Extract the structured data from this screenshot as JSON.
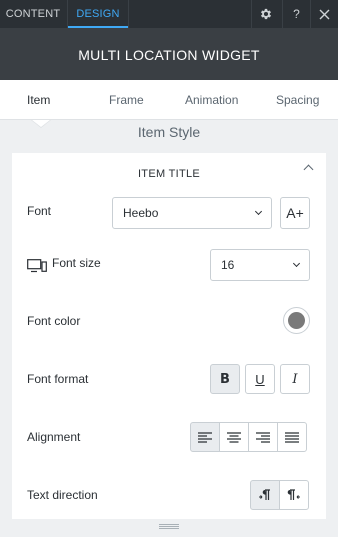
{
  "topbar": {
    "tabs": [
      {
        "label": "CONTENT",
        "active": false
      },
      {
        "label": "DESIGN",
        "active": true
      }
    ],
    "icons": {
      "settings": "gear-icon",
      "help": "?",
      "close": "close-icon"
    }
  },
  "title": "MULTI LOCATION WIDGET",
  "nav": [
    {
      "label": "Item",
      "active": true
    },
    {
      "label": "Frame",
      "active": false
    },
    {
      "label": "Animation",
      "active": false
    },
    {
      "label": "Spacing",
      "active": false
    }
  ],
  "section_caption": "Item Style",
  "panel": {
    "header": "ITEM TITLE",
    "font": {
      "label": "Font",
      "value": "Heebo",
      "add_label": "A+"
    },
    "font_size": {
      "label": "Font size",
      "value": "16"
    },
    "font_color": {
      "label": "Font color",
      "color": "#7a7a7a"
    },
    "font_format": {
      "label": "Font format",
      "bold": "B",
      "underline": "U",
      "italic": "I",
      "bold_active": true
    },
    "alignment": {
      "label": "Alignment",
      "options": [
        "left",
        "center",
        "right",
        "justify"
      ],
      "selected": "left"
    },
    "text_direction": {
      "label": "Text direction",
      "options": [
        "ltr",
        "rtl"
      ],
      "selected": "ltr"
    }
  },
  "colors": {
    "accent": "#3fa9f5",
    "topbar": "#2b3035",
    "titlebar": "#3a3f44",
    "background": "#eef0f2"
  }
}
